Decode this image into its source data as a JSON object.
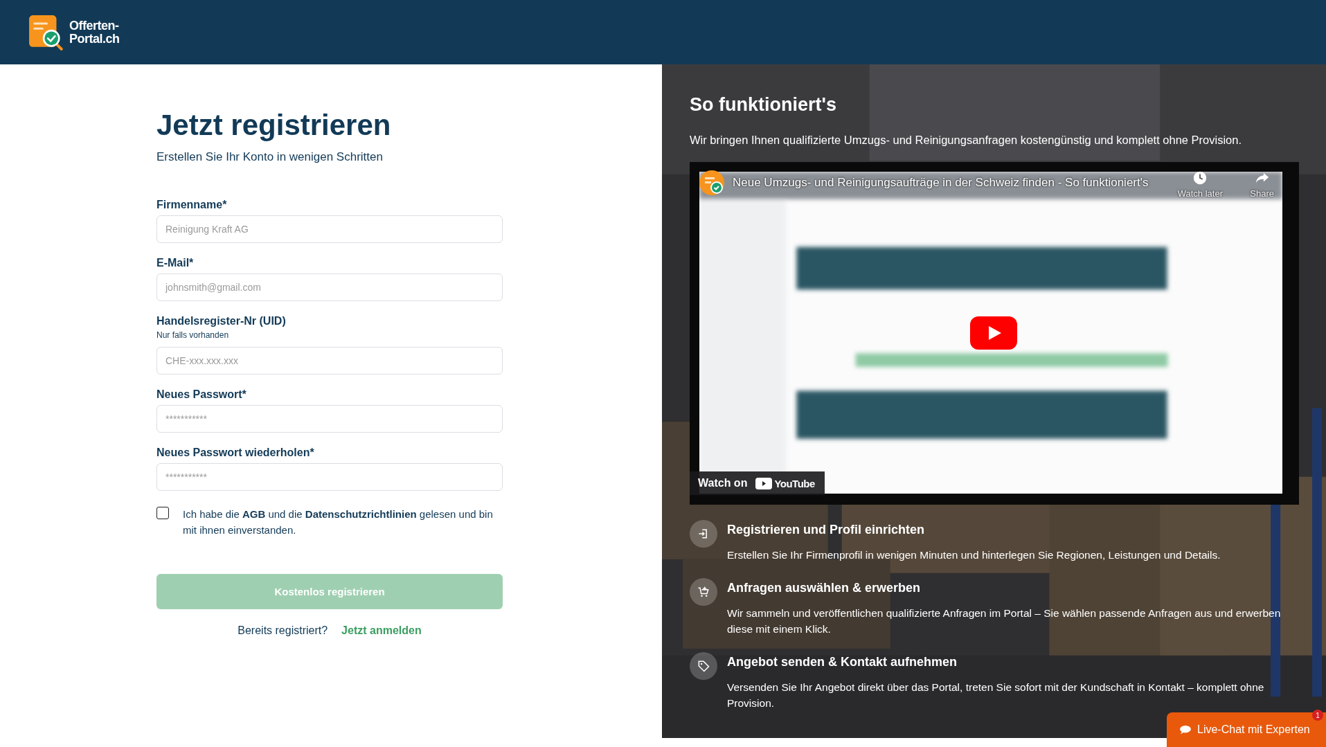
{
  "header": {
    "logo_lines": [
      "Offerten-",
      "Portal.ch"
    ]
  },
  "form": {
    "title": "Jetzt registrieren",
    "subtitle": "Erstellen Sie Ihr Konto in wenigen Schritten",
    "fields": [
      {
        "label": "Firmenname*",
        "placeholder": "Reinigung Kraft AG"
      },
      {
        "label": "E-Mail*",
        "placeholder": "johnsmith@gmail.com"
      },
      {
        "label": "Handelsregister-Nr (UID)",
        "hint": "Nur falls vorhanden",
        "placeholder": "CHE-xxx.xxx.xxx"
      },
      {
        "label": "Neues Passwort*",
        "placeholder": "***********"
      },
      {
        "label": "Neues Passwort wiederholen*",
        "placeholder": "***********"
      }
    ],
    "consent": {
      "checked": false,
      "text": "Ich habe die **AGB** und die **Datenschutzrichtlinien** gelesen und bin mit ihnen einverstanden."
    },
    "submit": {
      "label": "Kostenlos registrieren",
      "disabled": true
    },
    "login_prompt": {
      "text": "Bereits registriert?",
      "link": "Jetzt anmelden"
    }
  },
  "how_it_works": {
    "title": "So funktioniert's",
    "intro": "Wir bringen Ihnen qualifizierte Umzugs- und Reinigungsanfragen kostengünstig und komplett ohne Provision.",
    "video": {
      "title": "Neue Umzugs- und Reinigungsaufträge in der Schweiz finden - So funktioniert's",
      "watch_later": "Watch later",
      "share": "Share",
      "watch_on": "Watch on",
      "youtube": "YouTube"
    },
    "steps": [
      {
        "title": "Registrieren und Profil einrichten",
        "text": "Erstellen Sie Ihr Firmenprofil in wenigen Minuten und hinterlegen Sie Regionen, Leistungen und Details."
      },
      {
        "title": "Anfragen auswählen & erwerben",
        "text": "Wir sammeln und veröffentlichen qualifizierte Anfragen im Portal – Sie wählen passende Anfragen aus und erwerben diese mit einem Klick."
      },
      {
        "title": "Angebot senden & Kontakt aufnehmen",
        "text": "Versenden Sie Ihr Angebot direkt über das Portal, treten Sie sofort mit der Kundschaft in Kontakt – komplett ohne Provision."
      }
    ]
  },
  "live_chat": {
    "label": "Live-Chat mit Experten",
    "badge": "1"
  }
}
